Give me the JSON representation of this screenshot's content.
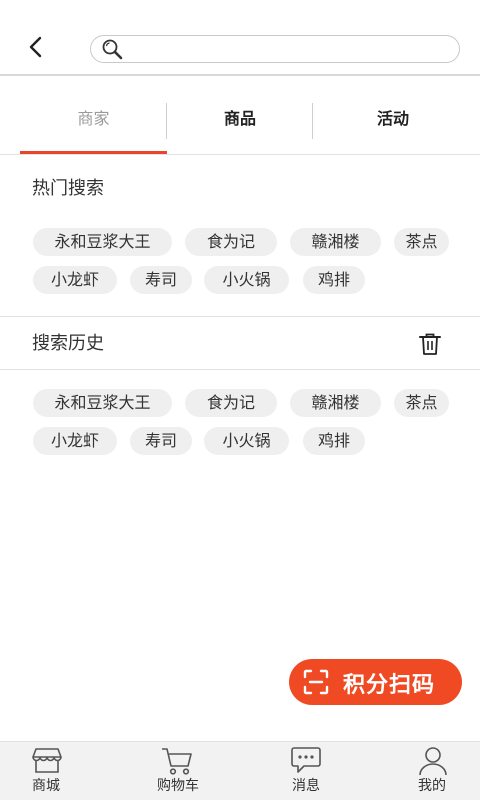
{
  "search": {
    "placeholder": "",
    "value": ""
  },
  "tabs": [
    {
      "label": "商家",
      "active": true
    },
    {
      "label": "商品",
      "active": false
    },
    {
      "label": "活动",
      "active": false
    }
  ],
  "hot_search": {
    "title": "热门搜索",
    "row1": [
      "永和豆浆大王",
      "食为记",
      "赣湘楼",
      "茶点"
    ],
    "row2": [
      "小龙虾",
      "寿司",
      "小火锅",
      "鸡排"
    ]
  },
  "history": {
    "title": "搜索历史",
    "row1": [
      "永和豆浆大王",
      "食为记",
      "赣湘楼",
      "茶点"
    ],
    "row2": [
      "小龙虾",
      "寿司",
      "小火锅",
      "鸡排"
    ]
  },
  "scan_button": {
    "label": "积分扫码"
  },
  "bottom_nav": [
    {
      "label": "商城",
      "icon": "store-icon"
    },
    {
      "label": "购物车",
      "icon": "cart-icon"
    },
    {
      "label": "消息",
      "icon": "message-icon"
    },
    {
      "label": "我的",
      "icon": "profile-icon"
    }
  ],
  "colors": {
    "accent": "#e8452c",
    "scan_button": "#f04a24",
    "tag_bg": "#efefef"
  }
}
